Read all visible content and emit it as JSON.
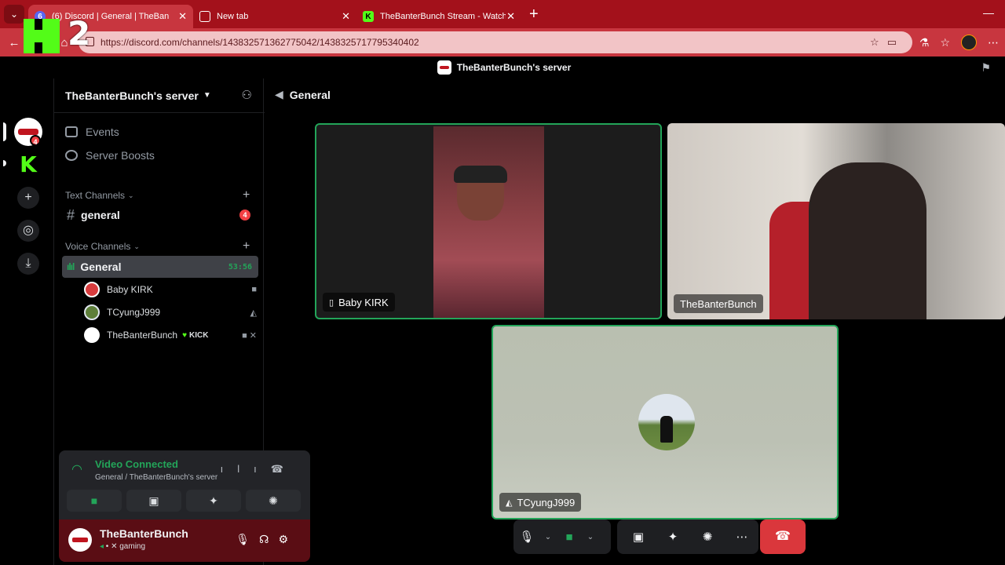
{
  "browser": {
    "tabs": [
      {
        "title": "(6) Discord | General | TheBan",
        "badge": "6"
      },
      {
        "title": "New tab"
      },
      {
        "title": "TheBanterBunch Stream - Watch L"
      }
    ],
    "url": "https://discord.com/channels/1438325713627750​42/1438325717795340402"
  },
  "overlay": {
    "kick_number": "2"
  },
  "app": {
    "window_title": "TheBanterBunch's server"
  },
  "rail": {
    "banter_badge": "4"
  },
  "sidebar": {
    "server_name": "TheBanterBunch's server",
    "links": [
      "Events",
      "Server Boosts"
    ],
    "text_category": "Text Channels",
    "text_channel": {
      "name": "general",
      "badge": "4"
    },
    "voice_category": "Voice Channels",
    "voice_channel": {
      "name": "General",
      "timer": "53:56"
    },
    "members": [
      {
        "name": "Baby KIRK"
      },
      {
        "name": "TCyungJ999"
      },
      {
        "name": "TheBanterBunch",
        "tag": "KICK"
      }
    ]
  },
  "voice_panel": {
    "title": "Video Connected",
    "subtitle": "General / TheBanterBunch's server"
  },
  "user_panel": {
    "name": "TheBanterBunch",
    "status": "gaming"
  },
  "main": {
    "channel_title": "General",
    "tiles": [
      {
        "label": "Baby KIRK"
      },
      {
        "label": "TheBanterBunch"
      },
      {
        "label": "TCyungJ999"
      }
    ]
  },
  "colors": {
    "accent_green": "#23a559",
    "kick_green": "#53fc18",
    "browser_red": "#a3111b",
    "hangup_red": "#da373c"
  }
}
